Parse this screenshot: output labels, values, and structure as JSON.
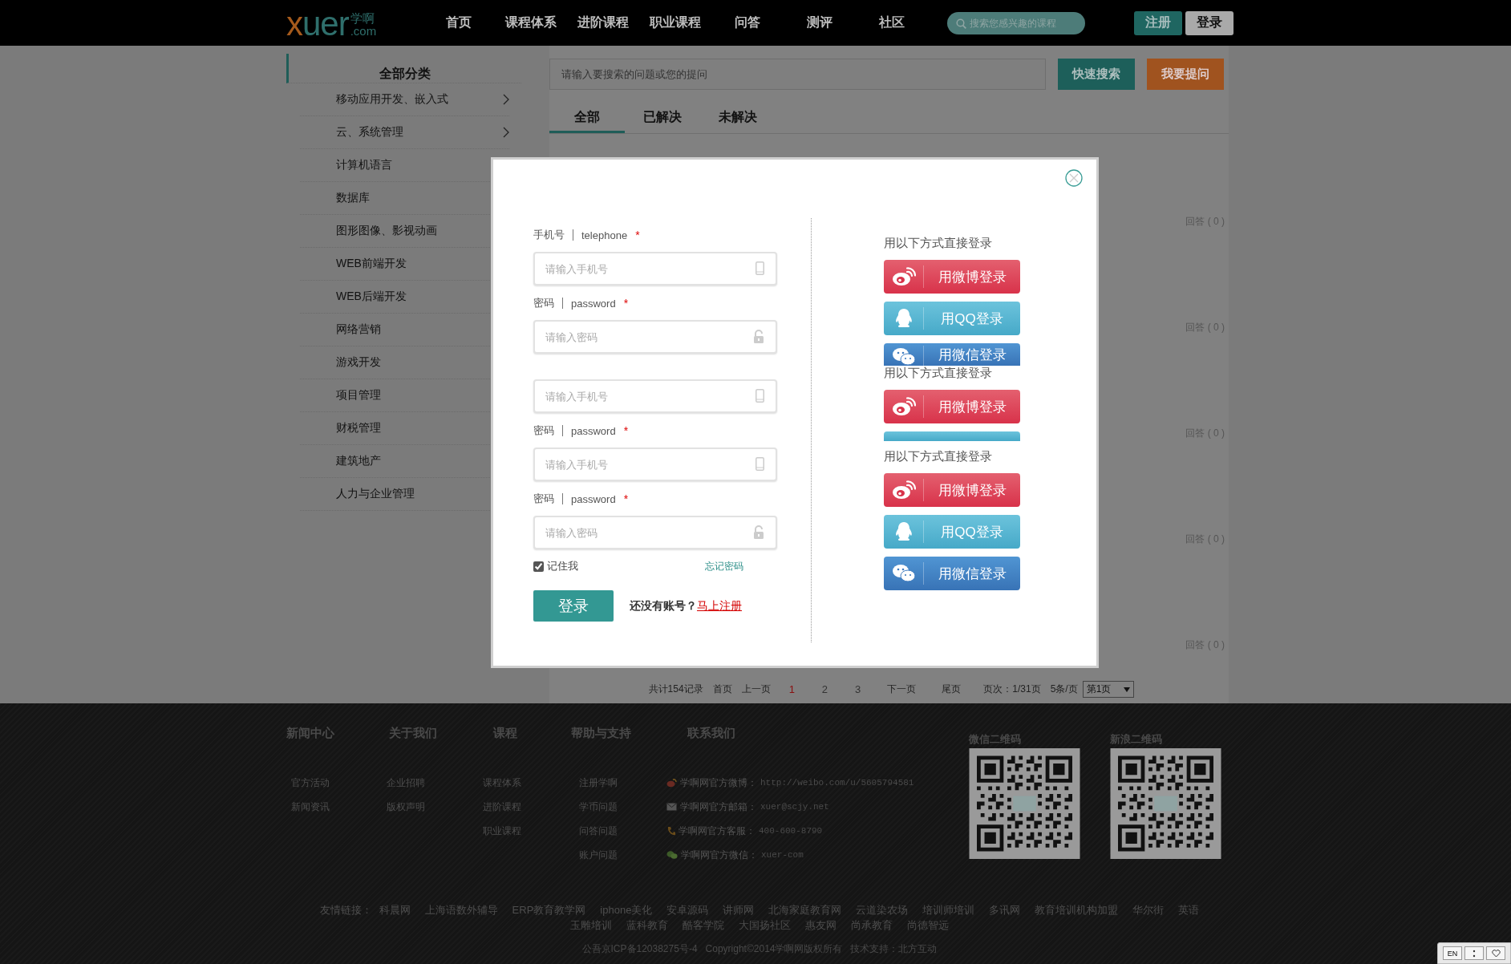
{
  "header": {
    "logo": {
      "main": "xuer",
      "cn": "学啊",
      "domain": ".com"
    },
    "nav": [
      {
        "label": "首页"
      },
      {
        "label": "课程体系"
      },
      {
        "label": "进阶课程"
      },
      {
        "label": "职业课程"
      },
      {
        "label": "问答"
      },
      {
        "label": "测评"
      },
      {
        "label": "社区"
      }
    ],
    "search": {
      "placeholder": "搜索您感兴趣的课程"
    },
    "buttons": [
      {
        "label": "注册",
        "kind": "primary"
      },
      {
        "label": "登录",
        "kind": "secondary"
      }
    ]
  },
  "sidebar": {
    "title": "全部分类",
    "items": [
      {
        "label": "移动应用开发、嵌入式",
        "expandable": true
      },
      {
        "label": "云、系统管理",
        "expandable": true
      },
      {
        "label": "计算机语言"
      },
      {
        "label": "数据库"
      },
      {
        "label": "图形图像、影视动画"
      },
      {
        "label": "WEB前端开发"
      },
      {
        "label": "WEB后端开发"
      },
      {
        "label": "网络营销"
      },
      {
        "label": "游戏开发"
      },
      {
        "label": "项目管理"
      },
      {
        "label": "财税管理"
      },
      {
        "label": "建筑地产"
      },
      {
        "label": "人力与企业管理"
      }
    ]
  },
  "questions": {
    "search": {
      "placeholder": "请输入要搜索的问题或您的提问"
    },
    "buttons": [
      {
        "label": "快速搜索",
        "kind": "search"
      },
      {
        "label": "我要提问",
        "kind": "ask"
      }
    ],
    "tabs": [
      {
        "label": "全部",
        "selected": true
      },
      {
        "label": "已解决",
        "selected": false
      },
      {
        "label": "未解决",
        "selected": false
      }
    ],
    "answer_counts": [
      "回答 ( 0 )",
      "回答 ( 0 )",
      "回答 ( 0 )",
      "回答 ( 0 )",
      "回答 ( 0 )"
    ]
  },
  "pagination": {
    "summary": "共计154记录",
    "first": "首页",
    "prev": "上一页",
    "pages": [
      {
        "label": "1",
        "selected": true
      },
      {
        "label": "2",
        "selected": false
      },
      {
        "label": "3",
        "selected": false
      }
    ],
    "next": "下一页",
    "last": "尾页",
    "page_info": "页次：1/31页",
    "per_page": "5条/页",
    "select": "第1页"
  },
  "login_modal": {
    "form": [
      {
        "kind": "label",
        "cn": "手机号",
        "en": "telephone",
        "required_mark": "*"
      },
      {
        "kind": "phone_field",
        "placeholder": "请输入手机号"
      },
      {
        "kind": "label",
        "cn": "密码",
        "en": "password",
        "required_mark": "*"
      },
      {
        "kind": "password_field",
        "placeholder": "请输入密码"
      },
      {
        "kind": "phone_field",
        "placeholder": "请输入手机号"
      },
      {
        "kind": "label",
        "cn": "密码",
        "en": "password",
        "required_mark": "*"
      },
      {
        "kind": "phone_field",
        "placeholder": "请输入手机号"
      },
      {
        "kind": "label",
        "cn": "密码",
        "en": "password",
        "required_mark": "*"
      },
      {
        "kind": "password_field",
        "placeholder": "请输入密码"
      }
    ],
    "remember": {
      "label": "记住我",
      "checked": true
    },
    "forgot": "忘记密码",
    "submit": "登录",
    "register_prompt": "还没有账号？",
    "register_link": "马上注册",
    "social": [
      {
        "kind": "heading",
        "text": "用以下方式直接登录"
      },
      {
        "kind": "weibo",
        "label": "用微博登录",
        "clipped": false
      },
      {
        "kind": "qq",
        "label": "用QQ登录",
        "clipped": false
      },
      {
        "kind": "wechat",
        "label": "用微信登录",
        "clipped": true
      },
      {
        "kind": "heading",
        "text": "用以下方式直接登录"
      },
      {
        "kind": "weibo",
        "label": "用微博登录",
        "clipped": false
      },
      {
        "kind": "qq",
        "clipped": true
      },
      {
        "kind": "heading",
        "text": "用以下方式直接登录"
      },
      {
        "kind": "weibo",
        "label": "用微博登录",
        "clipped": false
      },
      {
        "kind": "qq",
        "label": "用QQ登录",
        "clipped": false
      },
      {
        "kind": "wechat",
        "label": "用微信登录",
        "clipped": false
      }
    ]
  },
  "footer": {
    "columns": [
      {
        "title": "新闻中心",
        "links": [
          "官方活动",
          "新闻资讯"
        ]
      },
      {
        "title": "关于我们",
        "links": [
          "企业招聘",
          "版权声明"
        ]
      },
      {
        "title": "课程",
        "links": [
          "课程体系",
          "进阶课程",
          "职业课程"
        ]
      },
      {
        "title": "帮助与支持",
        "links": [
          "注册学啊",
          "学币问题",
          "问答问题",
          "账户问题"
        ]
      }
    ],
    "contact": {
      "title": "联系我们",
      "items": [
        {
          "kind": "weibo",
          "label": "学啊网官方微博：",
          "value": "http://weibo.com/u/5605794581"
        },
        {
          "kind": "email",
          "label": "学啊网官方邮箱：",
          "value": "xuer@scjy.net"
        },
        {
          "kind": "phone",
          "label": "学啊网官方客服：",
          "value": "400-600-8790"
        },
        {
          "kind": "wechat",
          "label": "学啊网官方微信：",
          "value": "xuer-com"
        }
      ]
    },
    "qr_codes": [
      {
        "title": "微信二维码"
      },
      {
        "title": "新浪二维码"
      }
    ],
    "friend_links": {
      "label": "友情链接：",
      "links": [
        "科晨网",
        "上海语数外辅导",
        "ERP教育教学网",
        "iphone美化",
        "安卓源码",
        "讲师网",
        "北海家庭教育网",
        "云道染农场",
        "培训师培训",
        "多讯网",
        "教育培训机构加盟",
        "华尔街",
        "英语",
        "玉雕培训",
        "蓝科教育",
        "酷客学院",
        "大国扬社区",
        "惠友网",
        "尚承教育",
        "尚德智远"
      ]
    },
    "copyright": [
      "公吾京ICP备12038275号-4",
      "Copyright©2014学啊网版权所有",
      "技术支持：北方互动"
    ]
  },
  "corner_widget": {
    "language": "EN"
  }
}
